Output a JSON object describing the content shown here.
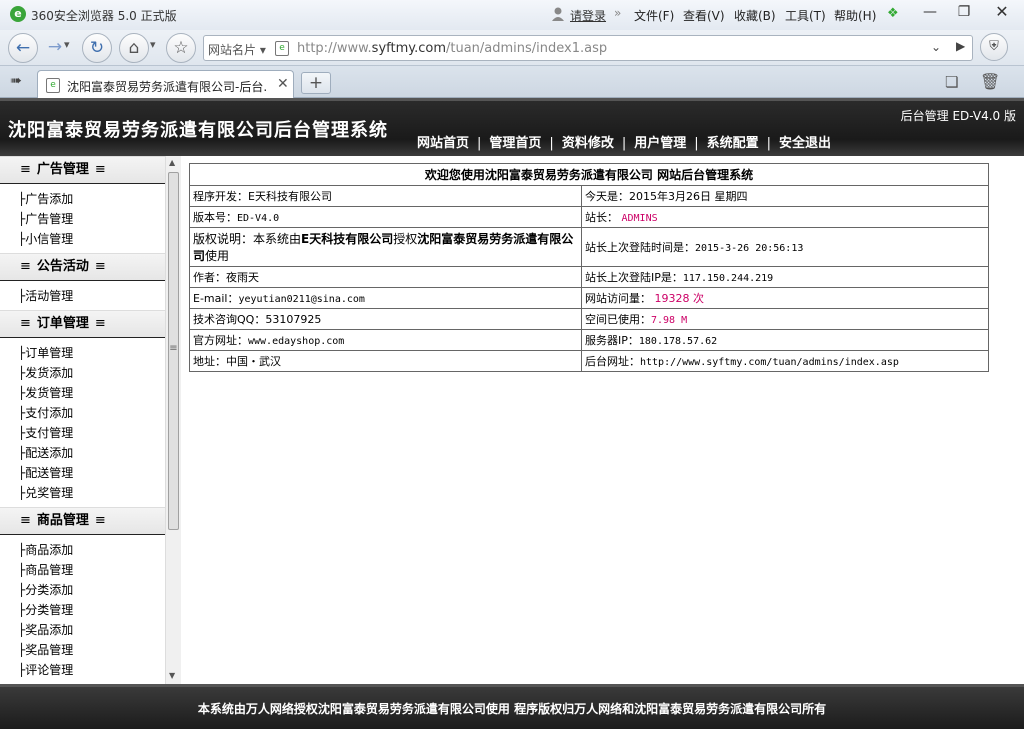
{
  "browser": {
    "title": "360安全浏览器 5.0 正式版",
    "login": "请登录",
    "menus": [
      "文件(F)",
      "查看(V)",
      "收藏(B)",
      "工具(T)",
      "帮助(H)"
    ],
    "site_card": "网站名片",
    "url_prefix": "http://www.",
    "url_domain": "syftmy.com",
    "url_path": "/tuan/admins/index1.asp",
    "tab_title": "沈阳富泰贸易劳务派遣有限公司-后台...",
    "new_tab": "+"
  },
  "header": {
    "title": "沈阳富泰贸易劳务派遣有限公司后台管理系统",
    "version": "后台管理 ED-V4.0 版",
    "nav": [
      "网站首页",
      "管理首页",
      "资料修改",
      "用户管理",
      "系统配置",
      "安全退出"
    ]
  },
  "sidebar": {
    "groups": [
      {
        "title": "广告管理",
        "items": [
          "广告添加",
          "广告管理",
          "小信管理"
        ]
      },
      {
        "title": "公告活动",
        "items": [
          "活动管理"
        ]
      },
      {
        "title": "订单管理",
        "items": [
          "订单管理",
          "发货添加",
          "发货管理",
          "支付添加",
          "支付管理",
          "配送添加",
          "配送管理",
          "兑奖管理"
        ]
      },
      {
        "title": "商品管理",
        "items": [
          "商品添加",
          "商品管理",
          "分类添加",
          "分类管理",
          "奖品添加",
          "奖品管理",
          "评论管理"
        ]
      }
    ]
  },
  "info": {
    "heading": "欢迎您使用沈阳富泰贸易劳务派遣有限公司 网站后台管理系统",
    "developer_label": "程序开发：",
    "developer_value": "E天科技有限公司",
    "today_label": "今天是：",
    "today_value": "2015年3月26日 星期四",
    "version_label": "版本号：",
    "version_value": "ED-V4.0",
    "admin_label": "站长：",
    "admin_value": "ADMINS",
    "copyright_label": "版权说明：",
    "copyright_pre": "本系统由",
    "copyright_company": "E天科技有限公司",
    "copyright_mid": "授权",
    "copyright_client": "沈阳富泰贸易劳务派遣有限公司",
    "copyright_post": "使用",
    "lastlogin_label": "站长上次登陆时间是：",
    "lastlogin_value": "2015-3-26 20:56:13",
    "author_label": "作者：",
    "author_value": "夜雨天",
    "lastip_label": "站长上次登陆IP是：",
    "lastip_value": "117.150.244.219",
    "email_label": "E-mail：",
    "email_value": "yeyutian0211@sina.com",
    "visits_label": "网站访问量：",
    "visits_value": "19328 次",
    "qq_label": "技术咨询QQ：",
    "qq_value": "53107925",
    "space_label": "空间已使用：",
    "space_value": "7.98 M",
    "site_label": "官方网址：",
    "site_value": "www.edayshop.com",
    "server_label": "服务器IP：",
    "server_value": "180.178.57.62",
    "address_label": "地址：",
    "address_value": "中国・武汉",
    "admin_url_label": "后台网址：",
    "admin_url_value": "http://www.syftmy.com/tuan/admins/index.asp"
  },
  "footer": {
    "text": "本系统由万人网络授权沈阳富泰贸易劳务派遣有限公司使用 程序版权归万人网络和沈阳富泰贸易劳务派遣有限公司所有"
  }
}
